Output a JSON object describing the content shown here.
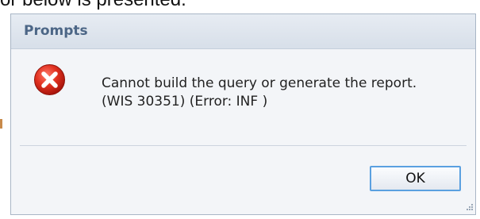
{
  "background": {
    "text": "or below is presented."
  },
  "dialog": {
    "title": "Prompts",
    "icon": "error-icon",
    "message": "Cannot build the query or generate the report. (WIS 30351) (Error: INF )",
    "ok_label": "OK"
  },
  "colors": {
    "title_text": "#4c6686",
    "icon_red": "#d42a1e",
    "button_border": "#5aa0e0"
  }
}
